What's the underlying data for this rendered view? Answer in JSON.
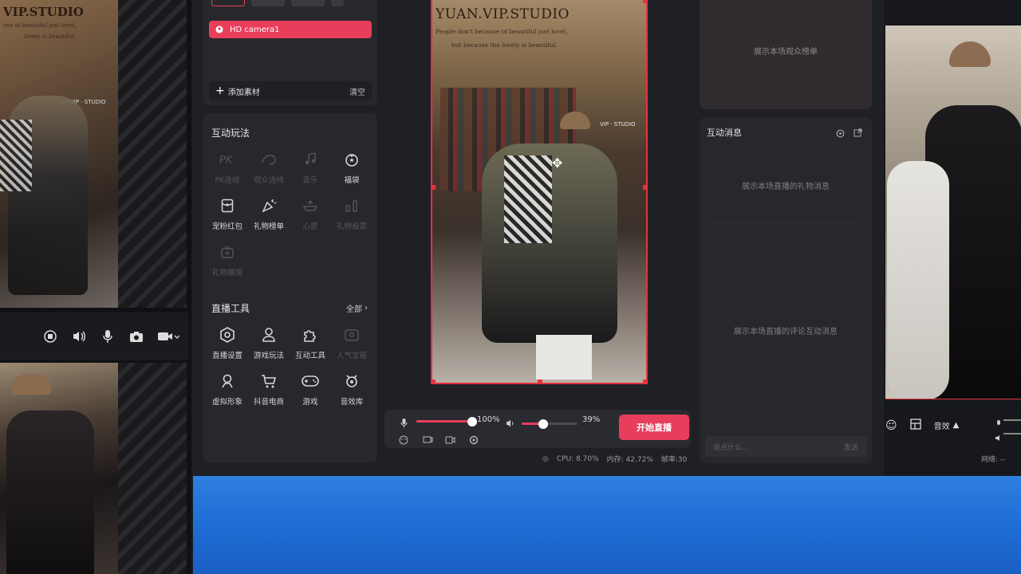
{
  "left_window": {
    "icons": [
      "stop-icon",
      "volume-icon",
      "mic-icon",
      "camera-snap-icon",
      "video-icon"
    ]
  },
  "sources": {
    "active_source": "HD camera1",
    "add_material": "添加素材",
    "clear": "清空"
  },
  "interactive": {
    "title": "互动玩法",
    "items": [
      {
        "label": "PK连线",
        "enabled": false,
        "icon": "pk-icon"
      },
      {
        "label": "观众连线",
        "enabled": false,
        "icon": "audience-link-icon"
      },
      {
        "label": "音乐",
        "enabled": false,
        "icon": "music-icon"
      },
      {
        "label": "福袋",
        "enabled": true,
        "icon": "lucky-bag-icon"
      },
      {
        "label": "宠粉红包",
        "enabled": true,
        "icon": "red-packet-icon"
      },
      {
        "label": "礼物榜单",
        "enabled": true,
        "icon": "gift-list-icon"
      },
      {
        "label": "心愿",
        "enabled": false,
        "icon": "wish-icon"
      },
      {
        "label": "礼物投票",
        "enabled": false,
        "icon": "gift-vote-icon"
      },
      {
        "label": "礼物展馆",
        "enabled": false,
        "icon": "gift-hall-icon"
      }
    ]
  },
  "tools": {
    "title": "直播工具",
    "all": "全部",
    "items": [
      {
        "label": "直播设置",
        "enabled": true,
        "icon": "live-settings-icon"
      },
      {
        "label": "游戏玩法",
        "enabled": true,
        "icon": "game-play-icon"
      },
      {
        "label": "互动工具",
        "enabled": true,
        "icon": "puzzle-icon"
      },
      {
        "label": "人气宝箱",
        "enabled": false,
        "icon": "treasure-box-icon"
      },
      {
        "label": "虚拟形象",
        "enabled": true,
        "icon": "avatar-icon"
      },
      {
        "label": "抖音电商",
        "enabled": true,
        "icon": "cart-icon"
      },
      {
        "label": "游戏",
        "enabled": true,
        "icon": "gamepad-icon"
      },
      {
        "label": "音效库",
        "enabled": true,
        "icon": "sound-lib-icon"
      }
    ]
  },
  "preview": {
    "studio_title": "YUAN.VIP.STUDIO",
    "studio_line1": "People don't because of beautiful just lovel,",
    "studio_line2": "but because the lovely is beautiful.",
    "shelf_sign": "VIP · STUDIO"
  },
  "left_preview": {
    "studio_title": "VIP.STUDIO",
    "studio_line1": "use of beautiful just lovel,",
    "studio_line2": "lovely is beautiful.",
    "shelf_sign": "VIP · STUDIO"
  },
  "audio": {
    "mic_percent": 100,
    "mic_label": "100%",
    "speaker_percent": 39,
    "speaker_label": "39%"
  },
  "start_button": "开始直播",
  "status": {
    "cpu": "CPU: 8.70%",
    "memory": "内存: 42.72%",
    "fps": "帧率:30"
  },
  "audience": {
    "placeholder": "展示本场观众榜单"
  },
  "messages": {
    "title": "互动消息",
    "gift_placeholder": "展示本场直播的礼物消息",
    "comment_placeholder": "展示本场直播的评论互动消息",
    "input_placeholder": "说点什么...",
    "send": "发送"
  },
  "right_window": {
    "effects": "音效",
    "network": "网络: --"
  },
  "colors": {
    "accent": "#e83e5c",
    "panel": "#27282c",
    "taskbar": "#1f6fd6"
  }
}
